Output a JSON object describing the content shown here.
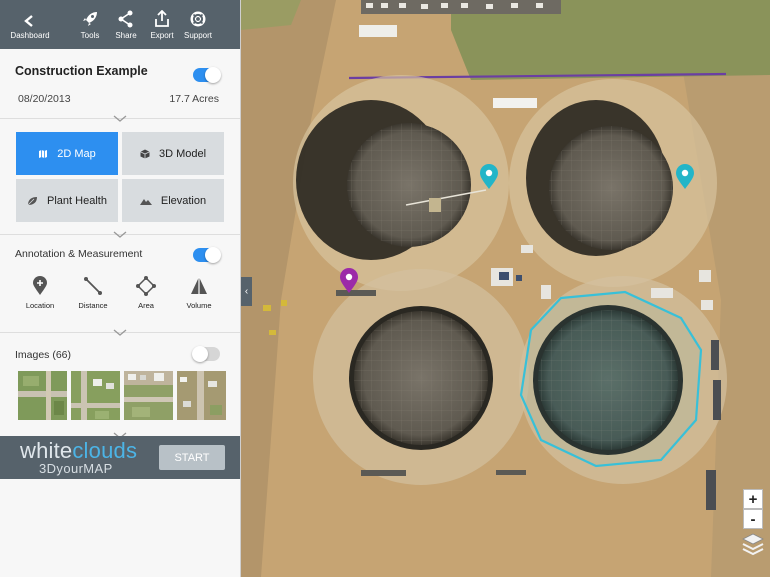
{
  "topbar": {
    "dashboard": "Dashboard",
    "tools": "Tools",
    "share": "Share",
    "export": "Export",
    "support": "Support"
  },
  "project": {
    "name": "Construction Example",
    "date": "08/20/2013",
    "size": "17.7 Acres",
    "visible": true
  },
  "views": {
    "map2d": "2D Map",
    "model3d": "3D Model",
    "plant_health": "Plant Health",
    "elevation": "Elevation",
    "active": "2D Map"
  },
  "annotation": {
    "title": "Annotation & Measurement",
    "enabled": true,
    "tools": {
      "location": "Location",
      "distance": "Distance",
      "area": "Area",
      "volume": "Volume"
    }
  },
  "images": {
    "title": "Images (66)",
    "enabled": false
  },
  "brand": {
    "name_part1": "white",
    "name_part2": "clouds",
    "tagline": "3DyourMAP",
    "start": "START"
  },
  "map": {
    "zoom_in": "+",
    "zoom_out": "-",
    "collapse": "‹"
  },
  "colors": {
    "accent": "#2d8ff0",
    "header": "#56626b",
    "pin_teal": "#23b5c8",
    "pin_purple": "#9c2aa8",
    "area_outline": "#38c0d8"
  },
  "icons": [
    "back-arrow-icon",
    "rocket-icon",
    "share-icon",
    "export-icon",
    "support-icon",
    "map-icon",
    "cube-icon",
    "leaf-icon",
    "mountain-icon",
    "location-pin-icon",
    "distance-icon",
    "area-icon",
    "volume-icon",
    "layers-icon"
  ]
}
